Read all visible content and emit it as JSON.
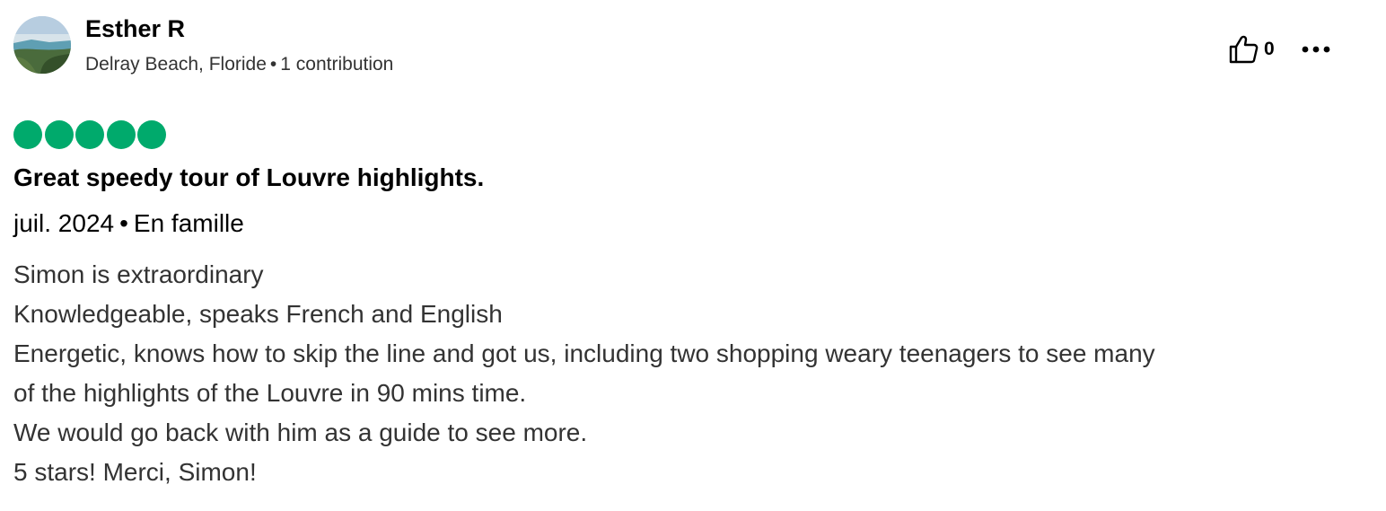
{
  "author": {
    "name": "Esther R",
    "location": "Delray Beach, Floride",
    "separator": "•",
    "contributions": "1 contribution"
  },
  "actions": {
    "helpful_icon": "thumbs-up-icon",
    "helpful_count": "0",
    "more_icon": "more-options-icon"
  },
  "rating": {
    "value": 5,
    "max": 5,
    "color": "#00aa6c"
  },
  "review": {
    "title": "Great speedy tour of Louvre highlights.",
    "date": "juil. 2024",
    "separator": "•",
    "trip_type": "En famille",
    "body_lines": [
      "Simon is extraordinary",
      "Knowledgeable, speaks French and English",
      "Energetic, knows how to skip the line and got us, including two shopping weary teenagers to see many",
      "of the highlights of the Louvre in 90 mins time.",
      "We would go back with him as a guide to see more.",
      "5 stars! Merci, Simon!"
    ]
  }
}
